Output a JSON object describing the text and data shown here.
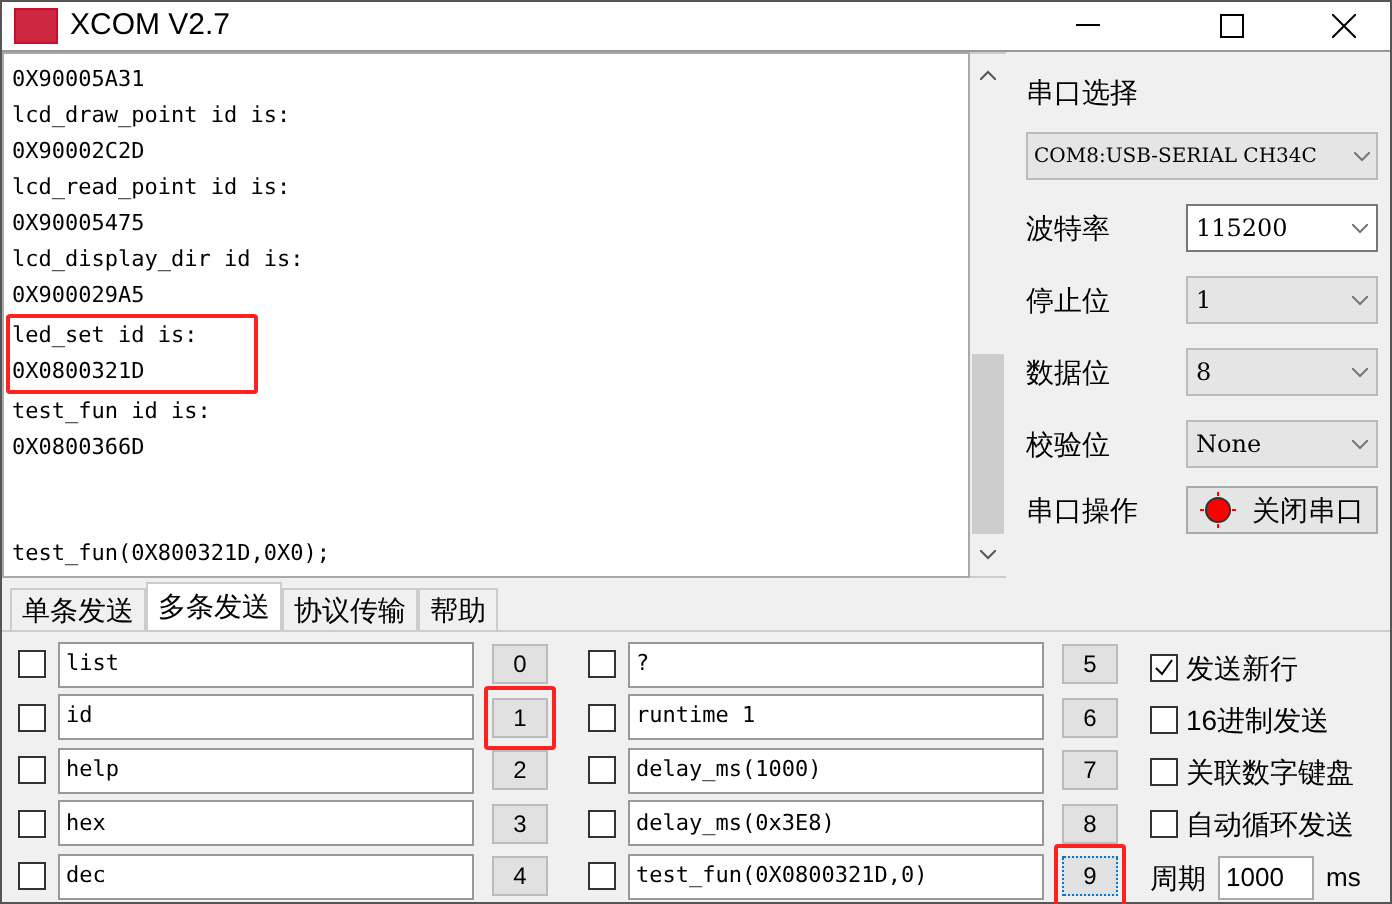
{
  "window": {
    "title": "XCOM V2.7"
  },
  "log": [
    {
      "text": "0X90005A31",
      "highlighted": false
    },
    {
      "text": "lcd_draw_point id is:",
      "highlighted": false
    },
    {
      "text": "0X90002C2D",
      "highlighted": false
    },
    {
      "text": "lcd_read_point id is:",
      "highlighted": false
    },
    {
      "text": "0X90005475",
      "highlighted": false
    },
    {
      "text": "lcd_display_dir id is:",
      "highlighted": false
    },
    {
      "text": "0X900029A5",
      "highlighted": false
    },
    {
      "text": "led_set id is:",
      "highlighted": true
    },
    {
      "text": "0X0800321D",
      "highlighted": true
    },
    {
      "text": "test_fun id is:",
      "highlighted": false
    },
    {
      "text": "0X0800366D",
      "highlighted": false
    }
  ],
  "log_last_line": "test_fun(0X800321D,0X0);",
  "settings": {
    "port_label": "串口选择",
    "port_value": "COM8:USB-SERIAL CH34C",
    "fields": [
      {
        "label": "波特率",
        "value": "115200",
        "editable": true
      },
      {
        "label": "停止位",
        "value": "1",
        "editable": false
      },
      {
        "label": "数据位",
        "value": "8",
        "editable": false
      },
      {
        "label": "校验位",
        "value": "None",
        "editable": false
      }
    ],
    "operation_label": "串口操作",
    "operation_button": "关闭串口"
  },
  "tabs": [
    {
      "label": "单条发送",
      "selected": false
    },
    {
      "label": "多条发送",
      "selected": true
    },
    {
      "label": "协议传输",
      "selected": false
    },
    {
      "label": "帮助",
      "selected": false
    }
  ],
  "commands": [
    {
      "checked": false,
      "text": "list",
      "button": "0",
      "highlighted": false,
      "focused": false
    },
    {
      "checked": false,
      "text": "id",
      "button": "1",
      "highlighted": true,
      "focused": false
    },
    {
      "checked": false,
      "text": "help",
      "button": "2",
      "highlighted": false,
      "focused": false
    },
    {
      "checked": false,
      "text": "hex",
      "button": "3",
      "highlighted": false,
      "focused": false
    },
    {
      "checked": false,
      "text": "dec",
      "button": "4",
      "highlighted": false,
      "focused": false
    },
    {
      "checked": false,
      "text": "?",
      "button": "5",
      "highlighted": false,
      "focused": false
    },
    {
      "checked": false,
      "text": "runtime 1",
      "button": "6",
      "highlighted": false,
      "focused": false
    },
    {
      "checked": false,
      "text": "delay_ms(1000)",
      "button": "7",
      "highlighted": false,
      "focused": false
    },
    {
      "checked": false,
      "text": "delay_ms(0x3E8)",
      "button": "8",
      "highlighted": false,
      "focused": false
    },
    {
      "checked": false,
      "text": "test_fun(0X0800321D,0)",
      "button": "9",
      "highlighted": true,
      "focused": true
    }
  ],
  "options": [
    {
      "label": "发送新行",
      "checked": true
    },
    {
      "label": "16进制发送",
      "checked": false
    },
    {
      "label": "关联数字键盘",
      "checked": false
    },
    {
      "label": "自动循环发送",
      "checked": false
    }
  ],
  "period": {
    "label": "周期",
    "value": "1000",
    "unit": "ms"
  }
}
